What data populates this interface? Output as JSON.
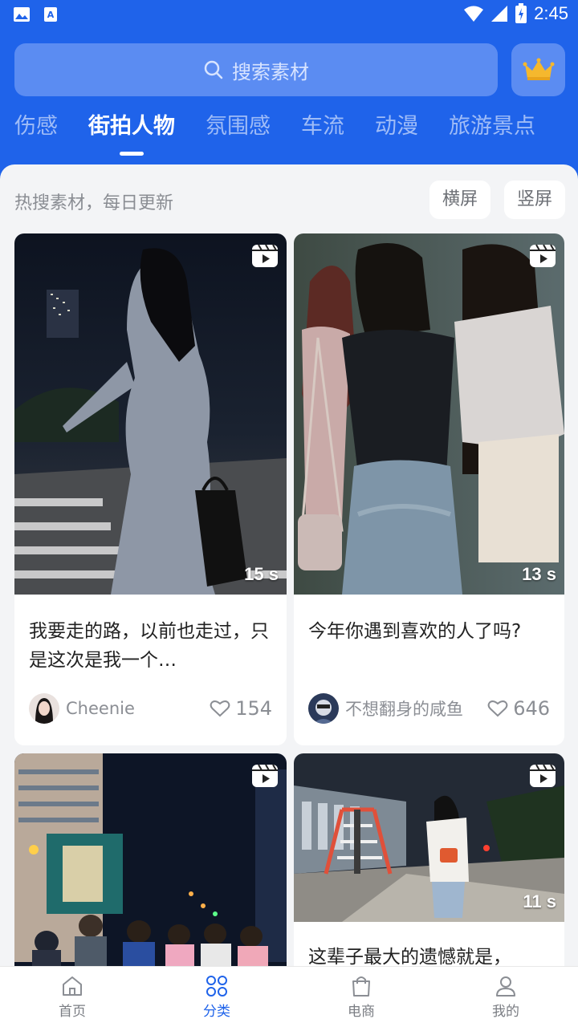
{
  "status_bar": {
    "time": "2:45"
  },
  "search": {
    "placeholder": "搜索素材"
  },
  "tabs": [
    {
      "label": "伤感"
    },
    {
      "label": "街拍人物",
      "active": true
    },
    {
      "label": "氛围感"
    },
    {
      "label": "车流"
    },
    {
      "label": "动漫"
    },
    {
      "label": "旅游景点"
    }
  ],
  "section": {
    "label": "热搜素材，每日更新",
    "orientation_landscape": "横屏",
    "orientation_portrait": "竖屏"
  },
  "cards": [
    {
      "duration": "15 s",
      "title": "我要走的路，以前也走过，只是这次是我一个…",
      "author": "Cheenie",
      "likes": "154"
    },
    {
      "duration": "13 s",
      "title": "今年你遇到喜欢的人了吗?",
      "author": "不想翻身的咸鱼",
      "likes": "646"
    },
    {
      "duration": "",
      "title": "",
      "author": "",
      "likes": ""
    },
    {
      "duration": "11 s",
      "title": "这辈子最大的遗憾就是，",
      "author": "",
      "likes": ""
    }
  ],
  "bottom_nav": [
    {
      "label": "首页",
      "icon": "home-icon"
    },
    {
      "label": "分类",
      "icon": "category-icon",
      "active": true
    },
    {
      "label": "电商",
      "icon": "shopping-bag-icon"
    },
    {
      "label": "我的",
      "icon": "user-icon"
    }
  ],
  "colors": {
    "brand": "#1f63ea",
    "search_bg": "#5b8cf2",
    "crown": "#f5b82e"
  }
}
